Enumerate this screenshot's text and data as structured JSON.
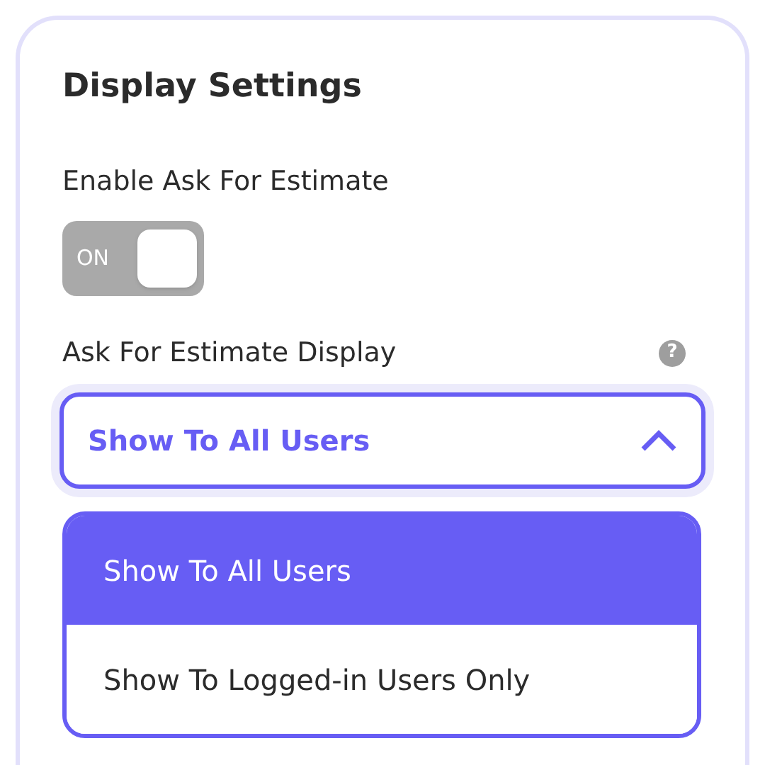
{
  "panel": {
    "title": "Display Settings"
  },
  "enable_setting": {
    "label": "Enable Ask For Estimate",
    "toggle": {
      "label": "ON",
      "on": true
    }
  },
  "display_setting": {
    "label": "Ask For Estimate Display",
    "help": "?",
    "dropdown": {
      "value": "Show To All Users",
      "expanded": true
    },
    "options": [
      {
        "label": "Show To All Users",
        "selected": true
      },
      {
        "label": "Show To Logged-in Users Only",
        "selected": false
      }
    ]
  }
}
